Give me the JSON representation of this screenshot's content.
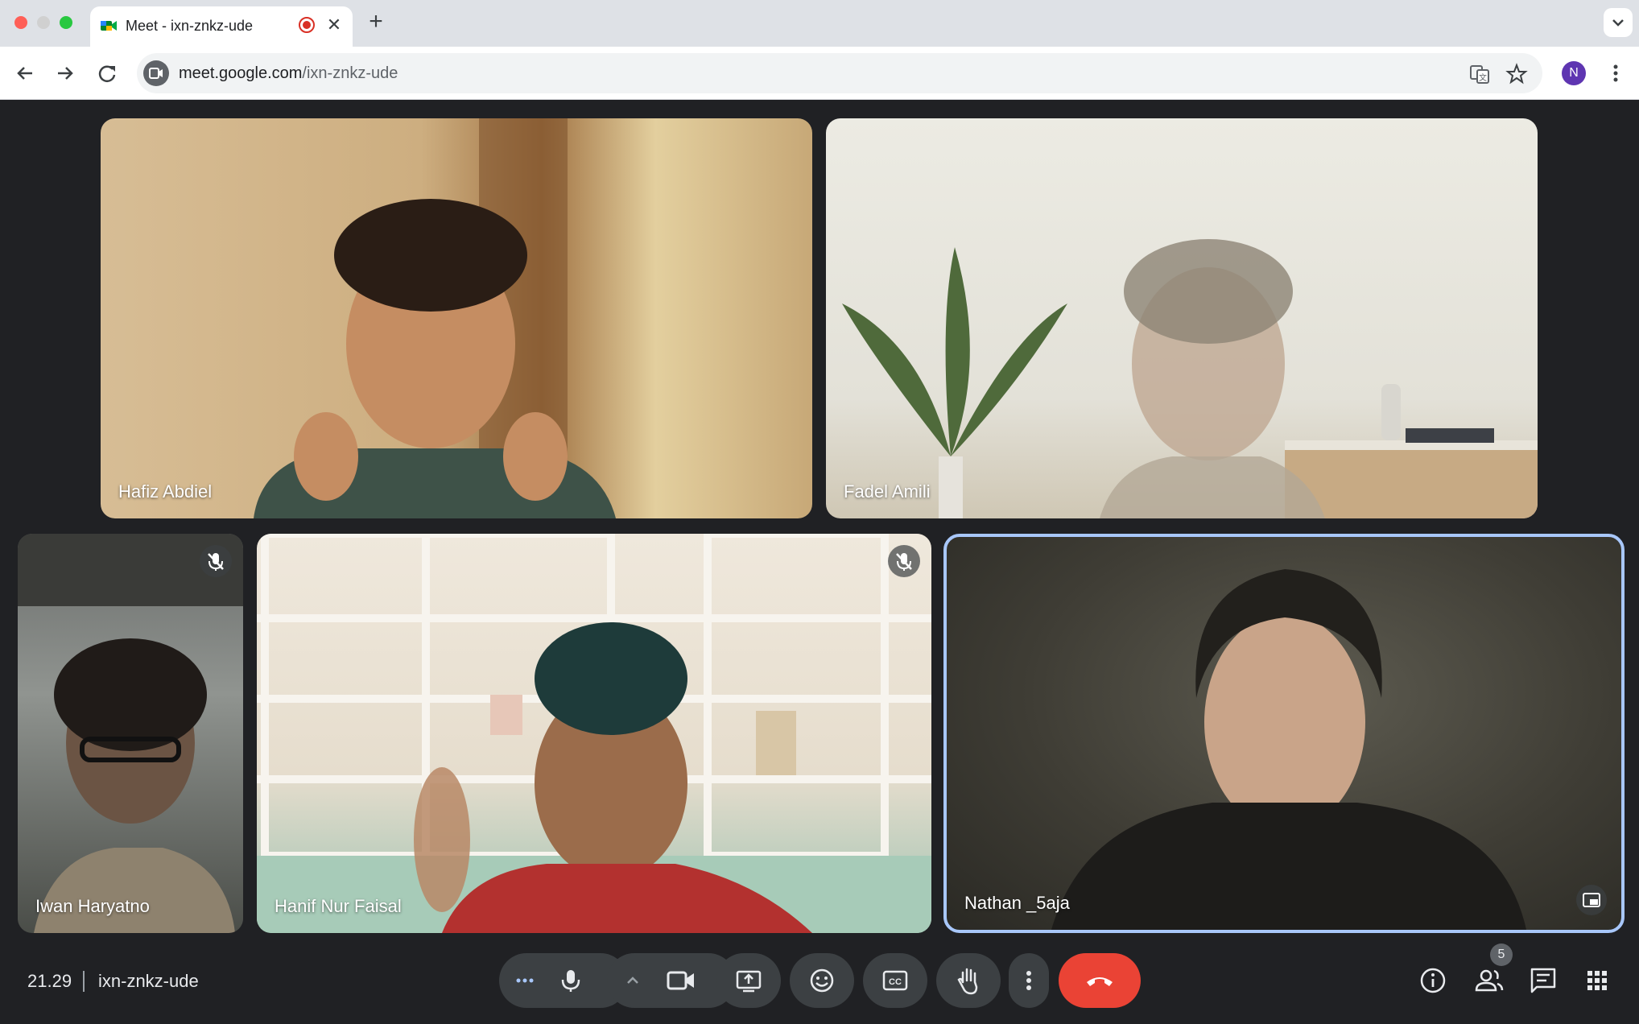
{
  "browser": {
    "tab_title": "Meet - ixn-znkz-ude",
    "url_domain": "meet.google.com",
    "url_path": "/ixn-znkz-ude",
    "profile_initial": "N"
  },
  "meeting": {
    "time": "21.29",
    "code": "ixn-znkz-ude",
    "participant_count": "5"
  },
  "participants": [
    {
      "name": "Hafiz Abdiel",
      "muted": false
    },
    {
      "name": "Fadel Amili",
      "muted": false
    },
    {
      "name": "Iwan Haryatno",
      "muted": true
    },
    {
      "name": "Hanif Nur Faisal",
      "muted": true
    },
    {
      "name": "Nathan _5aja",
      "muted": false,
      "active_speaker": true
    }
  ],
  "colors": {
    "end_call": "#ea4335",
    "active_border": "#a8c7fa",
    "control_bg": "#3c4043"
  }
}
